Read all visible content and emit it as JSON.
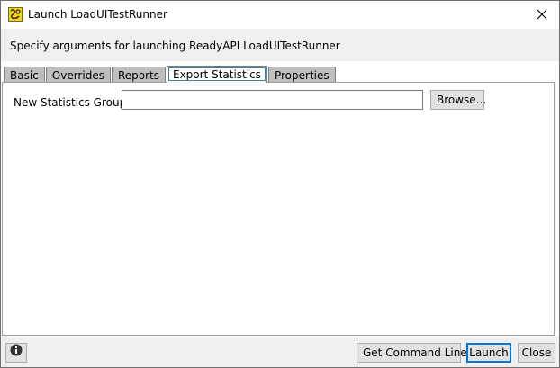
{
  "window": {
    "title": "Launch LoadUITestRunner"
  },
  "header": {
    "description": "Specify arguments for launching ReadyAPI LoadUITestRunner"
  },
  "tabs": [
    {
      "label": "Basic",
      "active": false
    },
    {
      "label": "Overrides",
      "active": false
    },
    {
      "label": "Reports",
      "active": false
    },
    {
      "label": "Export Statistics",
      "active": true
    },
    {
      "label": "Properties",
      "active": false
    }
  ],
  "export_statistics": {
    "new_group_label": "New Statistics Group:",
    "new_group_value": "",
    "browse_label": "Browse..."
  },
  "footer": {
    "get_command_line_label": "Get Command Line",
    "launch_label": "Launch",
    "close_label": "Close"
  },
  "icons": {
    "app": "loadui-app-icon",
    "close": "close-icon",
    "info": "info-icon"
  },
  "colors": {
    "header_band": "#f0f0f0",
    "tab_inactive": "#bfbfbf",
    "tab_active": "#ffffff",
    "focus_accent": "#0078d7",
    "app_icon": "#f2d21a"
  }
}
